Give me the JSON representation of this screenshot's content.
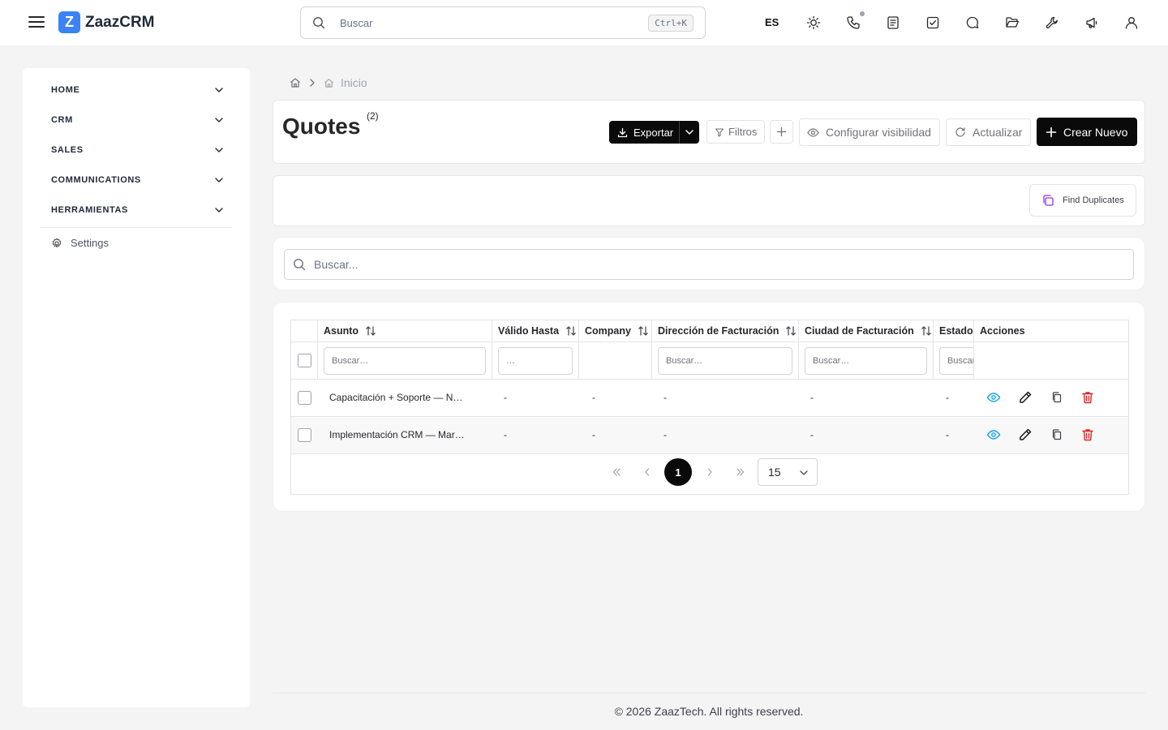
{
  "app": {
    "name": "ZaazCRM",
    "logo_letter": "Z",
    "accent_color": "#3b82f6"
  },
  "topbar": {
    "search_placeholder": "Buscar",
    "search_shortcut": "Ctrl+K",
    "language": "ES",
    "icons": [
      "sun-icon",
      "phone-icon",
      "notes-icon",
      "tasks-icon",
      "chat-icon",
      "folder-icon",
      "wrench-icon",
      "megaphone-icon",
      "user-icon"
    ]
  },
  "sidebar": {
    "items": [
      {
        "label": "HOME"
      },
      {
        "label": "CRM"
      },
      {
        "label": "SALES"
      },
      {
        "label": "COMMUNICATIONS"
      },
      {
        "label": "HERRAMIENTAS"
      }
    ],
    "settings_label": "Settings"
  },
  "breadcrumb": {
    "current": "Inicio"
  },
  "page": {
    "title": "Quotes",
    "count": "(2)"
  },
  "toolbar": {
    "export_label": "Exportar",
    "filters_label": "Filtros",
    "visibility_label": "Configurar visibilidad",
    "refresh_label": "Actualizar",
    "create_label": "Crear Nuevo"
  },
  "duplicates": {
    "label": "Find Duplicates"
  },
  "search": {
    "placeholder": "Buscar..."
  },
  "table": {
    "columns": [
      {
        "label": "Asunto",
        "sortable": true
      },
      {
        "label": "Válido Hasta",
        "sortable": true
      },
      {
        "label": "Company",
        "sortable": true
      },
      {
        "label": "Dirección de Facturación",
        "sortable": true
      },
      {
        "label": "Ciudad de Facturación",
        "sortable": true
      },
      {
        "label": "Estado",
        "sortable": false
      },
      {
        "label": "Acciones",
        "sortable": false
      }
    ],
    "filter_placeholders": {
      "asunto": "Buscar…",
      "valido_hasta": "…",
      "direccion": "Buscar…",
      "ciudad": "Buscar…",
      "estado": "Buscar…"
    },
    "rows": [
      {
        "asunto": "Capacitación + Soporte — N…",
        "valido_hasta": "-",
        "company": "-",
        "direccion": "-",
        "ciudad": "-",
        "estado": "-"
      },
      {
        "asunto": "Implementación CRM — Mar…",
        "valido_hasta": "-",
        "company": "-",
        "direccion": "-",
        "ciudad": "-",
        "estado": "-"
      }
    ],
    "action_colors": {
      "view": "#0ea5e9",
      "edit": "#18181b",
      "copy": "#3f3f46",
      "delete": "#dc2626"
    }
  },
  "pagination": {
    "current_page": "1",
    "page_size": "15"
  },
  "footer": {
    "text": "© 2026 ZaazTech. All rights reserved."
  }
}
